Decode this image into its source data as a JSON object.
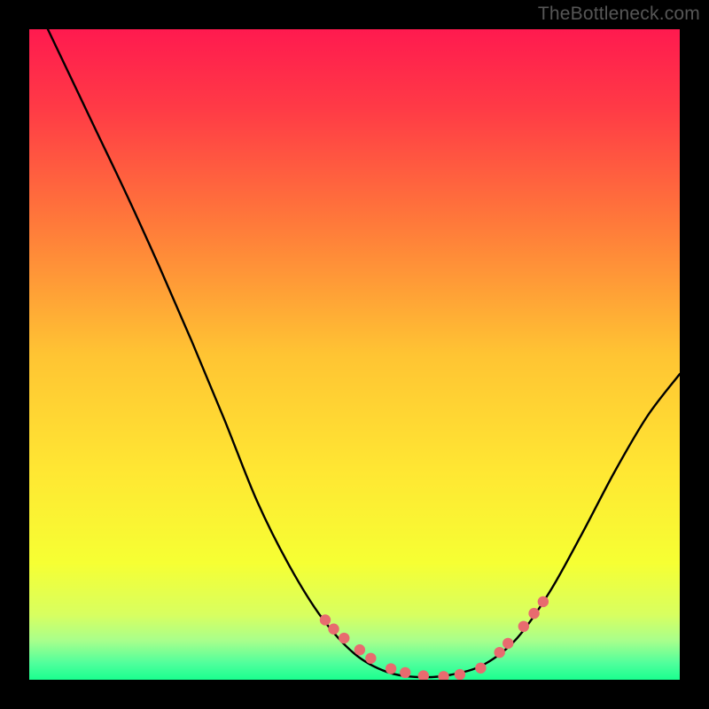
{
  "attribution": "TheBottleneck.com",
  "chart_data": {
    "type": "line",
    "title": "",
    "xlabel": "",
    "ylabel": "",
    "xlim": [
      0,
      1
    ],
    "ylim": [
      0,
      1
    ],
    "series": [
      {
        "name": "curve",
        "x": [
          0.0,
          0.05,
          0.1,
          0.15,
          0.2,
          0.25,
          0.3,
          0.35,
          0.4,
          0.45,
          0.5,
          0.55,
          0.6,
          0.65,
          0.7,
          0.75,
          0.8,
          0.85,
          0.9,
          0.95,
          1.0
        ],
        "y": [
          1.06,
          0.955,
          0.85,
          0.745,
          0.635,
          0.52,
          0.4,
          0.275,
          0.175,
          0.095,
          0.04,
          0.012,
          0.004,
          0.008,
          0.024,
          0.064,
          0.135,
          0.225,
          0.32,
          0.405,
          0.47
        ]
      },
      {
        "name": "highlight-points",
        "x": [
          0.455,
          0.468,
          0.484,
          0.508,
          0.525,
          0.556,
          0.578,
          0.606,
          0.637,
          0.662,
          0.694,
          0.723,
          0.736,
          0.76,
          0.776,
          0.79
        ],
        "y": [
          0.092,
          0.078,
          0.064,
          0.046,
          0.033,
          0.017,
          0.011,
          0.006,
          0.005,
          0.008,
          0.018,
          0.042,
          0.056,
          0.082,
          0.102,
          0.12
        ]
      }
    ],
    "gradient_stops": [
      {
        "offset": 0.0,
        "color": "#ff1a4f"
      },
      {
        "offset": 0.12,
        "color": "#ff3a46"
      },
      {
        "offset": 0.3,
        "color": "#ff7a3a"
      },
      {
        "offset": 0.5,
        "color": "#ffc433"
      },
      {
        "offset": 0.68,
        "color": "#ffe733"
      },
      {
        "offset": 0.82,
        "color": "#f6ff33"
      },
      {
        "offset": 0.9,
        "color": "#d8ff60"
      },
      {
        "offset": 0.94,
        "color": "#a8ff8c"
      },
      {
        "offset": 0.975,
        "color": "#4fff9c"
      },
      {
        "offset": 1.0,
        "color": "#1aff8f"
      }
    ],
    "marker_color": "#e86b6f"
  }
}
